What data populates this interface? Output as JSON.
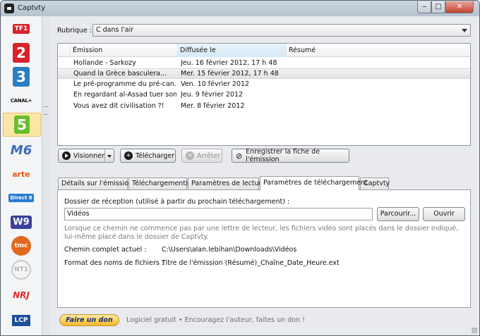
{
  "window": {
    "title": "Captvty"
  },
  "sidebar": {
    "channels": [
      {
        "name": "TF1",
        "color": "#d8232a"
      },
      {
        "name": "2",
        "color": "#d8232a"
      },
      {
        "name": "3",
        "color": "#2a7ec2"
      },
      {
        "name": "CANAL+",
        "color": "#111111"
      },
      {
        "name": "5",
        "color": "#ffffff",
        "active": true
      },
      {
        "name": "M6",
        "color": "#3b6bc0"
      },
      {
        "name": "arte",
        "color": "#e65a1a"
      },
      {
        "name": "Direct 8",
        "color": "#2b7bd1"
      },
      {
        "name": "W9",
        "color": "#3b3f9c"
      },
      {
        "name": "tmc",
        "color": "#e0691d"
      },
      {
        "name": "NT1",
        "color": "#b5b5b5"
      },
      {
        "name": "NRJ",
        "color": "#e22a2a"
      },
      {
        "name": "LCP",
        "color": "#1e4f9c"
      }
    ]
  },
  "rubrique": {
    "label": "Rubrique :",
    "value": "C dans l'air"
  },
  "list": {
    "columns": [
      "Émission",
      "Diffusée le",
      "Résumé"
    ],
    "rows": [
      {
        "emission": "Hollande - Sarkozy",
        "date": "Jeu. 16 février 2012, 17 h 48",
        "resume": ""
      },
      {
        "emission": "Quand la Grèce bascul­era...",
        "date": "Mer. 15 février 2012, 17 h 48",
        "resume": "",
        "selected": true
      },
      {
        "emission": "Le pré-programme du pré-can...",
        "date": "Ven. 10 février 2012",
        "resume": ""
      },
      {
        "emission": "En regardant al-Assad tuer son ...",
        "date": "Jeu. 9 février 2012",
        "resume": ""
      },
      {
        "emission": "Vous avez dit civilisation ?!",
        "date": "Mer. 8 février 2012",
        "resume": ""
      }
    ]
  },
  "toolbar": {
    "watch_label": "Visionner",
    "download_label": "Télécharger",
    "stop_label": "Arrêter",
    "save_sheet_label": "Enregistrer la fiche de l'émission"
  },
  "tabs": [
    {
      "label": "Détails sur l'émission"
    },
    {
      "label": "Téléchargements"
    },
    {
      "label": "Paramètres de lecture"
    },
    {
      "label": "Paramètres de téléchargement",
      "active": true
    },
    {
      "label": "Captvty"
    }
  ],
  "download_settings": {
    "folder_label": "Dossier de réception (utilisé à partir du prochain téléchargement) :",
    "folder_value": "Vidéos",
    "browse_label": "Parcourir...",
    "open_label": "Ouvrir",
    "hint": "Lorsque ce chemin ne commence pas par une lettre de lecteur, les fichiers vidéo sont placés dans le dossier indiqué, lui-même placé dans le dossier de Captvty.",
    "full_path_label": "Chemin complet actuel :",
    "full_path_value": "C:\\Users\\alan.lebihan\\Downloads\\Vidéos",
    "filename_format_label": "Format des noms de fichiers :",
    "filename_format_value": "Titre de l'émission (Résumé)_Chaîne_Date_Heure.ext"
  },
  "footer": {
    "donate_label": "Faire un don",
    "message": "Logiciel gratuit  •  Encouragez l'auteur, faites un don !"
  }
}
